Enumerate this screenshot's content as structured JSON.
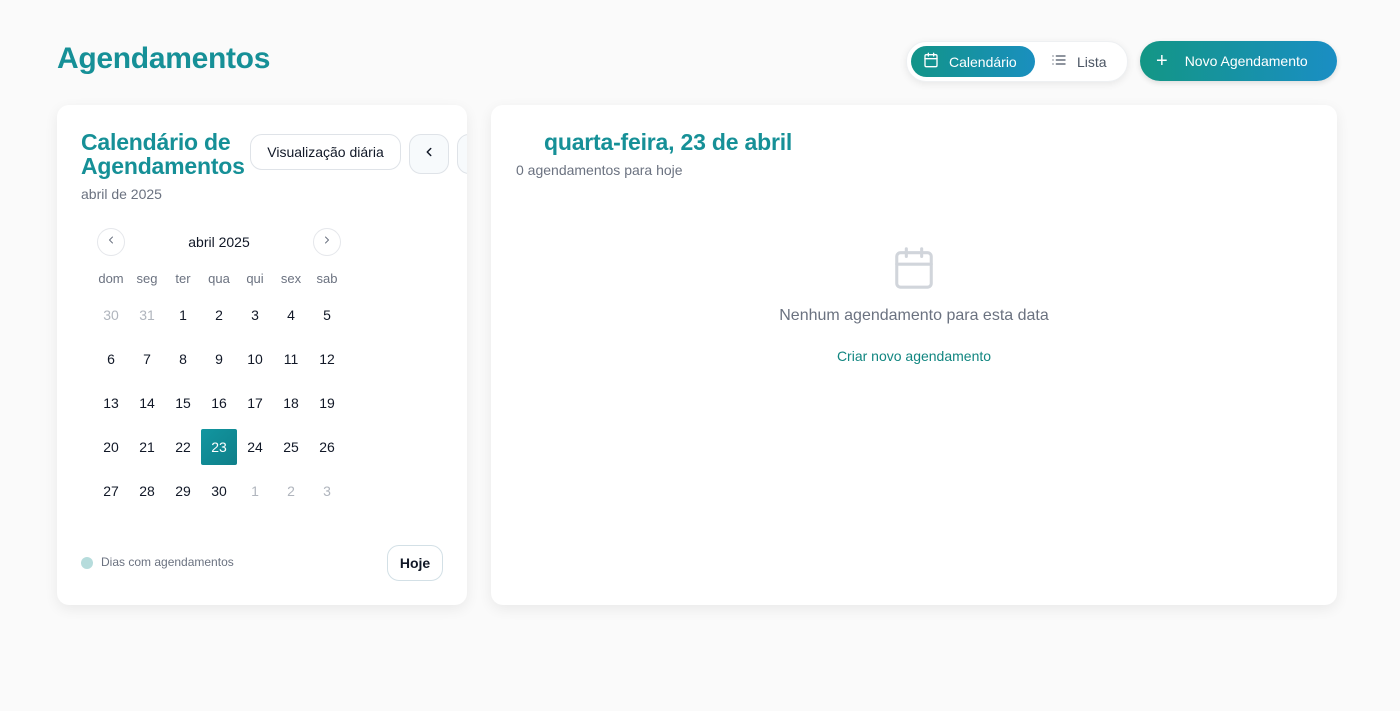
{
  "page": {
    "title": "Agendamentos"
  },
  "header": {
    "view_toggle": {
      "calendar_label": "Calendário",
      "list_label": "Lista",
      "active": "calendar"
    },
    "new_button_label": "Novo Agendamento"
  },
  "calendar_card": {
    "title": "Calendário de Agendamentos",
    "subtitle": "abril de 2025",
    "daily_view_label": "Visualização diária",
    "month_label": "abril 2025",
    "weekdays": [
      "dom",
      "seg",
      "ter",
      "qua",
      "qui",
      "sex",
      "sab"
    ],
    "weeks": [
      [
        "30",
        "31",
        "1",
        "2",
        "3",
        "4",
        "5"
      ],
      [
        "6",
        "7",
        "8",
        "9",
        "10",
        "11",
        "12"
      ],
      [
        "13",
        "14",
        "15",
        "16",
        "17",
        "18",
        "19"
      ],
      [
        "20",
        "21",
        "22",
        "23",
        "24",
        "25",
        "26"
      ],
      [
        "27",
        "28",
        "29",
        "30",
        "1",
        "2",
        "3"
      ]
    ],
    "selected_day": "23",
    "legend_label": "Dias com agendamentos",
    "today_label": "Hoje"
  },
  "day_panel": {
    "title": "quarta-feira, 23 de abril",
    "subtitle": "0 agendamentos para hoje",
    "empty_text": "Nenhum agendamento para esta data",
    "create_link": "Criar novo agendamento"
  },
  "colors": {
    "accent": "#169097",
    "accent_gradient_end": "#1a8fbf",
    "muted_text": "#6b7280"
  }
}
